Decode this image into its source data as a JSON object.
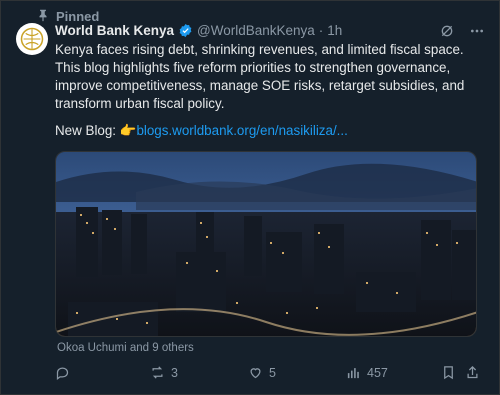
{
  "pinned": {
    "label": "Pinned"
  },
  "author": {
    "name": "World Bank Kenya",
    "handle": "@WorldBankKenya",
    "separator": "·",
    "time": "1h"
  },
  "tweet": {
    "text": "Kenya faces rising debt, shrinking revenues, and limited fiscal space. This blog highlights five reform priorities to strengthen governance, improve competitiveness, manage SOE risks, retarget subsidies, and transform urban fiscal policy.",
    "blog_prefix": "New Blog: ",
    "pointing_emoji": "👉",
    "link": "blogs.worldbank.org/en/nasikiliza/..."
  },
  "media": {
    "icon": "city-skyline-photo"
  },
  "liked_by": "Okoa Uchumi and 9 others",
  "actions": {
    "reply_count": "",
    "repost_count": "3",
    "like_count": "5",
    "views_count": "457"
  },
  "colors": {
    "background": "#15202b",
    "text": "#e7e9ea",
    "muted": "#8b98a5",
    "link": "#1d9bf0",
    "verified": "#1d9bf0"
  }
}
